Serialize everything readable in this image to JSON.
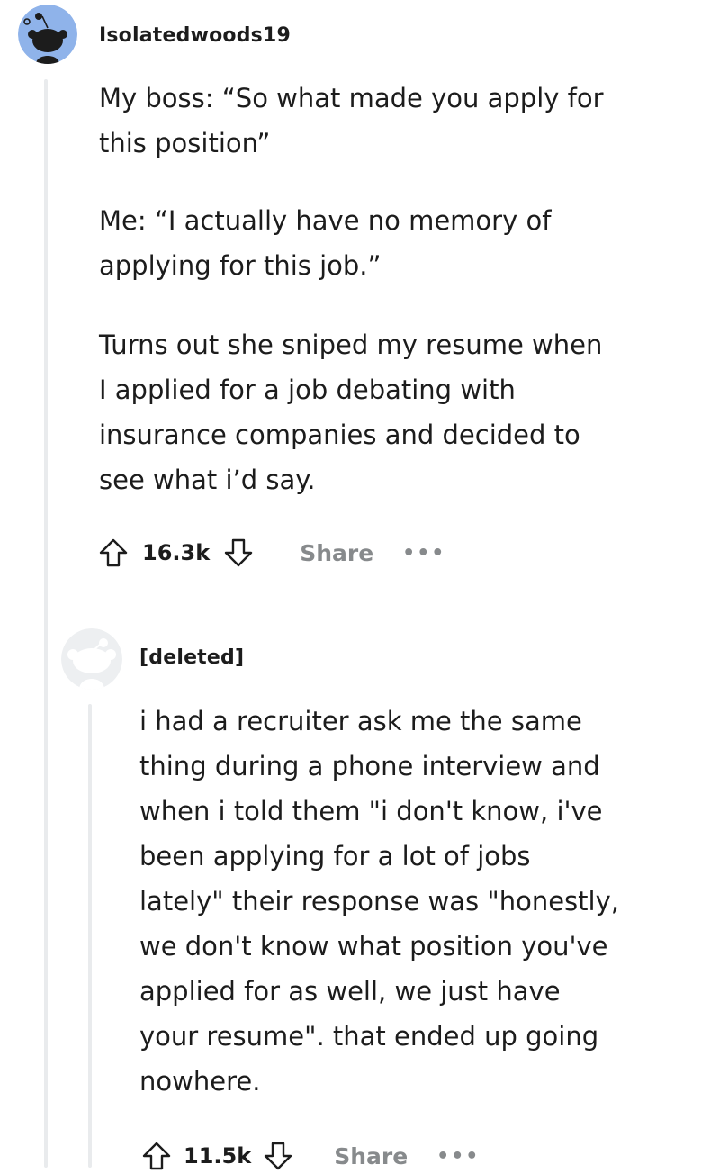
{
  "comments": [
    {
      "username": "Isolatedwoods19",
      "avatar_icon": "snoo-avatar-icon",
      "paragraphs": [
        {
          "lines": [
            "My boss: “So what made you apply for",
            "this position”"
          ]
        },
        {
          "lines": [
            "Me: “I actually have no memory of",
            "applying for this job.”"
          ]
        },
        {
          "lines": [
            "Turns out she sniped my resume when",
            "I applied for a job debating with",
            "insurance companies and decided to",
            "see what i’d say."
          ]
        }
      ],
      "score": "16.3k",
      "share_label": "Share",
      "more_label": "•••"
    },
    {
      "username": "[deleted]",
      "avatar_icon": "deleted-user-avatar-icon",
      "paragraphs": [
        {
          "lines": [
            "i had a recruiter ask me the same",
            "thing during a phone interview and",
            "when i told them \"i don't know, i've",
            "been applying for a lot of jobs",
            "lately\" their response was \"honestly,",
            "we don't know what position you've",
            "applied for as well, we just have",
            "your resume\". that ended up going",
            "nowhere."
          ]
        }
      ],
      "score": "11.5k",
      "share_label": "Share",
      "more_label": "•••"
    }
  ],
  "colors": {
    "avatar_bg": "#8fb3ea",
    "thread_line": "#e9ebed",
    "muted_text": "#878a8c",
    "body_text": "#1c1c1c"
  }
}
